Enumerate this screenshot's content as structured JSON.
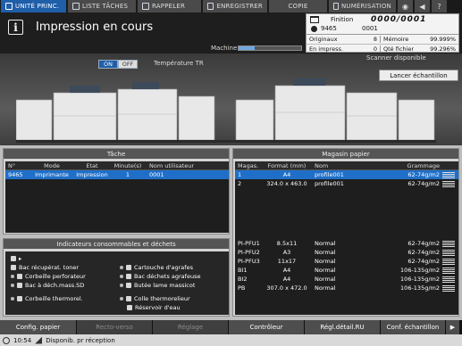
{
  "tabs": [
    {
      "label": "UNITÉ PRINC.",
      "active": true
    },
    {
      "label": "LISTE TÂCHES"
    },
    {
      "label": "RAPPELER"
    },
    {
      "label": "ENREGISTRER"
    },
    {
      "label": "COPIE"
    },
    {
      "label": "NUMÉRISATION"
    }
  ],
  "tab_icons": [
    "unknown-icon",
    "speaker-icon",
    "help-icon"
  ],
  "header": {
    "title": "Impression en cours",
    "machine_label": "Machine",
    "machine_progress_fraction": 0.25
  },
  "status": {
    "finish_label": "Finition",
    "finish_count": "0000/0001",
    "job_number": "9465",
    "job_sets": "0001"
  },
  "counters": {
    "originals_label": "Originaux",
    "originals_value": "8",
    "memory_label": "Mémoire",
    "memory_value": "99.999%",
    "printing_label": "En impress.",
    "printing_value": "0",
    "file_qty_label": "Qté fichier",
    "file_qty_value": "99.296%"
  },
  "machine_zone": {
    "toggle_on": "ON",
    "toggle_off": "OFF",
    "temp_label": "Température TR",
    "scanner_status": "Scanner disponible",
    "sample_button": "Lancer échantillon"
  },
  "task_panel": {
    "title": "Tâche",
    "columns": [
      "N°",
      "Mode",
      "Etat",
      "Minute(s)",
      "Nom utilisateur"
    ],
    "rows": [
      {
        "no": "9465",
        "mode": "Imprimante",
        "state": "Impression",
        "minutes": "1",
        "user": "0001",
        "selected": true
      }
    ]
  },
  "consumables": {
    "title": "Indicateurs consommables et déchets",
    "items": [
      {
        "label": "Bac récupérat. toner"
      },
      {
        "label": "Cartouche d'agrafes"
      },
      {
        "label": "Corbeille perforateur"
      },
      {
        "label": "Bac déchets agrafeuse"
      },
      {
        "label": "Bac à déch.mass.SD"
      },
      {
        "label": "Butée lame massicot"
      },
      {
        "label": "Corbeille thermorel."
      },
      {
        "label": "Colle thermorelieur"
      },
      {
        "label": "Réservoir d'eau"
      }
    ]
  },
  "stock_panel": {
    "title": "Magasin papier",
    "columns": [
      "Magas.",
      "Format (mm)",
      "Nom",
      "Grammage"
    ],
    "rows_top": [
      {
        "tray": "1",
        "size": "A4",
        "name": "profile001",
        "weight": "62-74g/m2",
        "selected": true
      },
      {
        "tray": "2",
        "size": "324.0 x 463.0",
        "name": "profile001",
        "weight": "62-74g/m2"
      }
    ],
    "rows_bottom": [
      {
        "tray": "PI-PFU1",
        "size": "8.5x11",
        "name": "Normal",
        "weight": "62-74g/m2"
      },
      {
        "tray": "PI-PFU2",
        "size": "A3",
        "name": "Normal",
        "weight": "62-74g/m2"
      },
      {
        "tray": "PI-PFU3",
        "size": "11x17",
        "name": "Normal",
        "weight": "62-74g/m2"
      },
      {
        "tray": "BI1",
        "size": "A4",
        "name": "Normal",
        "weight": "106-135g/m2"
      },
      {
        "tray": "BI2",
        "size": "A4",
        "name": "Normal",
        "weight": "106-135g/m2"
      },
      {
        "tray": "PB",
        "size": "307.0 x 472.0",
        "name": "Normal",
        "weight": "106-135g/m2"
      }
    ]
  },
  "fkeys": [
    {
      "label": "Config. papier",
      "enabled": true
    },
    {
      "label": "Recto-verso",
      "enabled": false
    },
    {
      "label": "Réglage",
      "enabled": false
    },
    {
      "label": "Contrôleur",
      "enabled": true
    },
    {
      "label": "Régl.détail.RU",
      "enabled": true
    },
    {
      "label": "Conf. échantillon",
      "enabled": true
    }
  ],
  "statusbar": {
    "time": "10:54",
    "message": "Disponib. pr réception"
  }
}
